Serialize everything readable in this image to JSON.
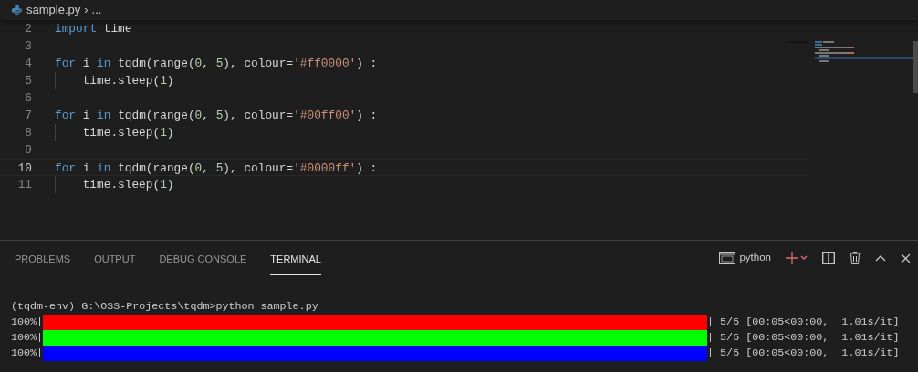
{
  "breadcrumb": {
    "file": "sample.py",
    "separator": "›",
    "rest": "..."
  },
  "editor": {
    "lines": [
      {
        "number": "2",
        "current": false,
        "tokens": [
          {
            "kind": "keyword",
            "text": "import"
          },
          {
            "kind": "plain",
            "text": " time"
          }
        ]
      },
      {
        "number": "3",
        "current": false
      },
      {
        "number": "4",
        "current": false,
        "tokens": [
          {
            "kind": "keyword",
            "text": "for"
          },
          {
            "kind": "plain",
            "text": " i "
          },
          {
            "kind": "keyword",
            "text": "in"
          },
          {
            "kind": "plain",
            "text": " tqdm(range("
          },
          {
            "kind": "number",
            "text": "0"
          },
          {
            "kind": "plain",
            "text": ", "
          },
          {
            "kind": "number",
            "text": "5"
          },
          {
            "kind": "plain",
            "text": "), colour="
          },
          {
            "kind": "string",
            "text": "'#ff0000'"
          },
          {
            "kind": "plain",
            "text": ") :"
          }
        ]
      },
      {
        "number": "5",
        "current": false,
        "indent": true,
        "tokens": [
          {
            "kind": "plain",
            "text": "time.sleep("
          },
          {
            "kind": "number",
            "text": "1"
          },
          {
            "kind": "plain",
            "text": ")"
          }
        ]
      },
      {
        "number": "6",
        "current": false
      },
      {
        "number": "7",
        "current": false,
        "tokens": [
          {
            "kind": "keyword",
            "text": "for"
          },
          {
            "kind": "plain",
            "text": " i "
          },
          {
            "kind": "keyword",
            "text": "in"
          },
          {
            "kind": "plain",
            "text": " tqdm(range("
          },
          {
            "kind": "number",
            "text": "0"
          },
          {
            "kind": "plain",
            "text": ", "
          },
          {
            "kind": "number",
            "text": "5"
          },
          {
            "kind": "plain",
            "text": "), colour="
          },
          {
            "kind": "string",
            "text": "'#00ff00'"
          },
          {
            "kind": "plain",
            "text": ") :"
          }
        ]
      },
      {
        "number": "8",
        "current": false,
        "indent": true,
        "tokens": [
          {
            "kind": "plain",
            "text": "time.sleep("
          },
          {
            "kind": "number",
            "text": "1"
          },
          {
            "kind": "plain",
            "text": ")"
          }
        ]
      },
      {
        "number": "9",
        "current": false
      },
      {
        "number": "10",
        "current": true,
        "tokens": [
          {
            "kind": "keyword",
            "text": "for"
          },
          {
            "kind": "plain",
            "text": " i "
          },
          {
            "kind": "keyword",
            "text": "in"
          },
          {
            "kind": "plain",
            "text": " tqdm(range("
          },
          {
            "kind": "number",
            "text": "0"
          },
          {
            "kind": "plain",
            "text": ", "
          },
          {
            "kind": "number",
            "text": "5"
          },
          {
            "kind": "plain",
            "text": "), colour="
          },
          {
            "kind": "string",
            "text": "'#0000ff'"
          },
          {
            "kind": "plain",
            "text": ") :"
          }
        ]
      },
      {
        "number": "11",
        "current": false,
        "indent": true,
        "tokens": [
          {
            "kind": "plain",
            "text": "time.sleep("
          },
          {
            "kind": "number",
            "text": "1"
          },
          {
            "kind": "plain",
            "text": ")"
          }
        ]
      }
    ]
  },
  "panel": {
    "tabs": [
      {
        "label": "PROBLEMS",
        "selected": false
      },
      {
        "label": "OUTPUT",
        "selected": false
      },
      {
        "label": "DEBUG CONSOLE",
        "selected": false
      },
      {
        "label": "TERMINAL",
        "selected": true
      }
    ],
    "terminal_name": "python",
    "terminal": {
      "prompt": "(tqdm-env) G:\\OSS-Projects\\tqdm>python sample.py",
      "progress": [
        {
          "percent": "100%|",
          "level": 1,
          "color": "#ff0000",
          "stats": "| 5/5 [00:05<00:00,  1.01s/it]"
        },
        {
          "percent": "100%|",
          "level": 1,
          "color": "#00ff00",
          "stats": "| 5/5 [00:05<00:00,  1.01s/it]"
        },
        {
          "percent": "100%|",
          "level": 1,
          "color": "#0000ff",
          "stats": "| 5/5 [00:05<00:00,  1.01s/it]"
        }
      ]
    }
  }
}
